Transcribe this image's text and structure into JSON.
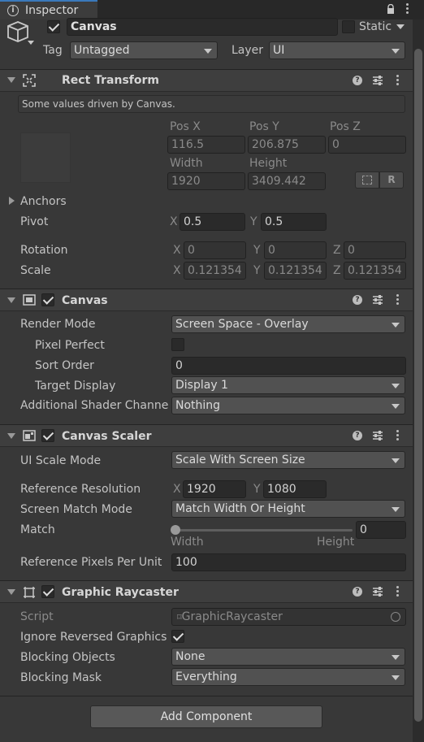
{
  "tab": {
    "label": "Inspector"
  },
  "object": {
    "name": "Canvas",
    "static_label": "Static",
    "tag_label": "Tag",
    "tag_value": "Untagged",
    "layer_label": "Layer",
    "layer_value": "UI"
  },
  "rect_transform": {
    "title": "Rect Transform",
    "info": "Some values driven by Canvas.",
    "pos_x_label": "Pos X",
    "pos_y_label": "Pos Y",
    "pos_z_label": "Pos Z",
    "pos_x": "116.5",
    "pos_y": "206.875",
    "pos_z": "0",
    "width_label": "Width",
    "height_label": "Height",
    "width": "1920",
    "height": "3409.442",
    "anchors_label": "Anchors",
    "pivot_label": "Pivot",
    "pivot_x": "0.5",
    "pivot_y": "0.5",
    "rotation_label": "Rotation",
    "rot_x": "0",
    "rot_y": "0",
    "rot_z": "0",
    "scale_label": "Scale",
    "scale_x": "0.121354",
    "scale_y": "0.121354",
    "scale_z": "0.121354",
    "x": "X",
    "y": "Y",
    "z": "Z"
  },
  "canvas": {
    "title": "Canvas",
    "render_mode_label": "Render Mode",
    "render_mode": "Screen Space - Overlay",
    "pixel_perfect_label": "Pixel Perfect",
    "sort_order_label": "Sort Order",
    "sort_order": "0",
    "target_display_label": "Target Display",
    "target_display": "Display 1",
    "shader_channels_label": "Additional Shader Channe",
    "shader_channels": "Nothing"
  },
  "scaler": {
    "title": "Canvas Scaler",
    "ui_scale_mode_label": "UI Scale Mode",
    "ui_scale_mode": "Scale With Screen Size",
    "ref_res_label": "Reference Resolution",
    "ref_x": "1920",
    "ref_y": "1080",
    "match_mode_label": "Screen Match Mode",
    "match_mode": "Match Width Or Height",
    "match_label": "Match",
    "match_value": "0",
    "match_fraction": 0,
    "match_left": "Width",
    "match_right": "Height",
    "ppu_label": "Reference Pixels Per Unit",
    "ppu": "100"
  },
  "raycaster": {
    "title": "Graphic Raycaster",
    "script_label": "Script",
    "script_value": "GraphicRaycaster",
    "ignore_reversed_label": "Ignore Reversed Graphics",
    "blocking_objects_label": "Blocking Objects",
    "blocking_objects": "None",
    "blocking_mask_label": "Blocking Mask",
    "blocking_mask": "Everything"
  },
  "add_component": "Add Component",
  "colors": {
    "accent": "#3a79bb",
    "background": "#383838",
    "header": "#3e3e3e"
  }
}
